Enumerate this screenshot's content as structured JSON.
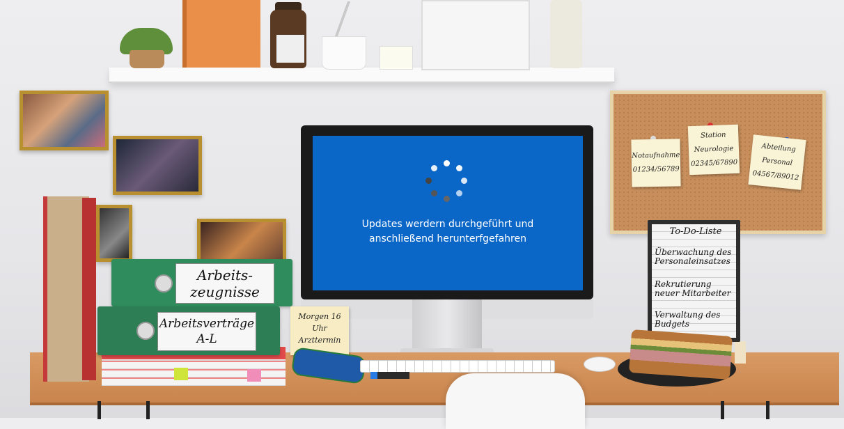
{
  "screen": {
    "status_line1": "Updates werdern durchgeführt und",
    "status_line2": "anschließend herunterfgefahren",
    "background_color": "#0a67c8"
  },
  "corkboard": {
    "notes": [
      {
        "line1": "Notaufnahme",
        "line2": "01234/56789"
      },
      {
        "line1": "Station",
        "line2": "Neurologie",
        "line3": "02345/67890"
      },
      {
        "line1": "Abteilung",
        "line2": "Personal",
        "line3": "04567/89012"
      }
    ]
  },
  "binders": [
    {
      "line1": "Arbeits-",
      "line2": "zeugnisse"
    },
    {
      "line1": "Arbeitsverträge",
      "line2": "A-L"
    }
  ],
  "desk_note": {
    "line1": "Morgen 16",
    "line2": "Uhr",
    "line3": "Arzttermin"
  },
  "todo": {
    "title": "To-Do-Liste",
    "items": [
      {
        "line1": "Überwachung des",
        "line2": "Personaleinsatzes"
      },
      {
        "line1": "Rekrutierung",
        "line2": "neuer Mitarbeiter"
      },
      {
        "line1": "Verwaltung des",
        "line2": "Budgets"
      }
    ]
  }
}
